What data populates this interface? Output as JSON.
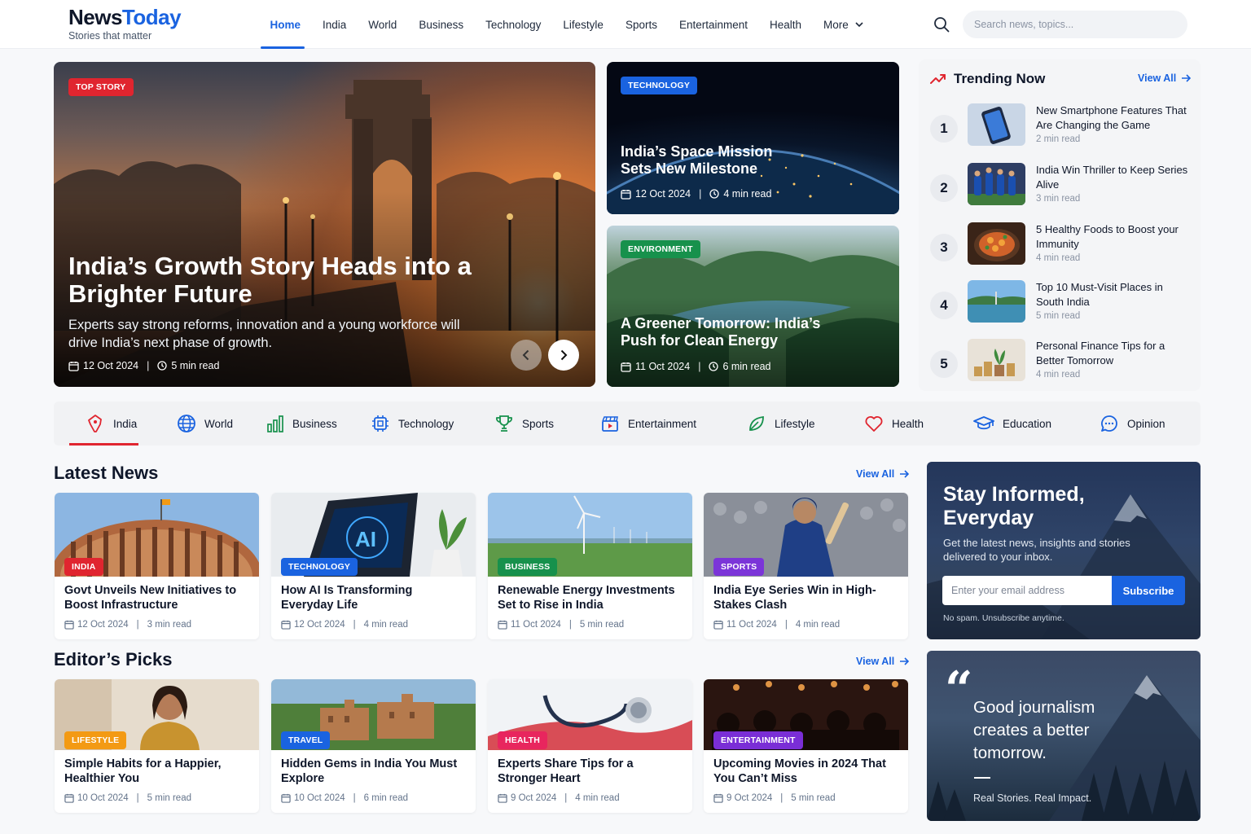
{
  "brand": {
    "name_a": "News",
    "name_b": "Today",
    "tagline": "Stories that matter",
    "accent": "#1a63e0"
  },
  "nav": {
    "items": [
      {
        "label": "Home",
        "active": true
      },
      {
        "label": "India"
      },
      {
        "label": "World"
      },
      {
        "label": "Business"
      },
      {
        "label": "Technology"
      },
      {
        "label": "Lifestyle"
      },
      {
        "label": "Sports"
      },
      {
        "label": "Entertainment"
      },
      {
        "label": "Health"
      },
      {
        "label": "More"
      }
    ]
  },
  "search": {
    "placeholder": "Search news, topics..."
  },
  "hero": {
    "badge": "TOP STORY",
    "title": "India’s Growth Story Heads into a Brighter Future",
    "subtitle": "Experts say strong reforms, innovation and a young workforce will drive India’s next phase of growth.",
    "date": "12 Oct 2024",
    "read": "5 min read"
  },
  "side_stories": [
    {
      "badge": "TECHNOLOGY",
      "title": "India’s Space Mission Sets New Milestone",
      "date": "12 Oct 2024",
      "read": "4 min read"
    },
    {
      "badge": "ENVIRONMENT",
      "title": "A Greener Tomorrow: India’s Push for Clean Energy",
      "date": "11 Oct 2024",
      "read": "6 min read"
    }
  ],
  "trending": {
    "title": "Trending Now",
    "view_all": "View All",
    "items": [
      {
        "num": "1",
        "title": "New Smartphone Features That Are Changing the Game",
        "read": "2 min read",
        "icon": "smartphone-image"
      },
      {
        "num": "2",
        "title": "India Win Thriller to Keep Series Alive",
        "read": "3 min read",
        "icon": "cricket-team-image"
      },
      {
        "num": "3",
        "title": "5 Healthy Foods to Boost your Immunity",
        "read": "4 min read",
        "icon": "food-bowl-image"
      },
      {
        "num": "4",
        "title": "Top 10 Must-Visit Places in South India",
        "read": "5 min read",
        "icon": "lake-landscape-image"
      },
      {
        "num": "5",
        "title": "Personal Finance Tips for a Better Tomorrow",
        "read": "4 min read",
        "icon": "coins-plant-image"
      }
    ]
  },
  "categories": [
    {
      "label": "India",
      "icon": "india-map-icon",
      "active": true
    },
    {
      "label": "World",
      "icon": "globe-icon"
    },
    {
      "label": "Business",
      "icon": "bar-chart-icon"
    },
    {
      "label": "Technology",
      "icon": "chip-icon"
    },
    {
      "label": "Sports",
      "icon": "trophy-icon"
    },
    {
      "label": "Entertainment",
      "icon": "clapperboard-icon"
    },
    {
      "label": "Lifestyle",
      "icon": "leaf-icon"
    },
    {
      "label": "Health",
      "icon": "heart-icon"
    },
    {
      "label": "Education",
      "icon": "graduation-cap-icon"
    },
    {
      "label": "Opinion",
      "icon": "chat-bubble-icon"
    }
  ],
  "latest": {
    "title": "Latest News",
    "view_all": "View All",
    "items": [
      {
        "badge": "INDIA",
        "title": "Govt Unveils New Initiatives to Boost Infrastructure",
        "date": "12 Oct 2024",
        "read": "3 min read",
        "color": "#e0252f"
      },
      {
        "badge": "TECHNOLOGY",
        "title": "How AI Is Transforming Everyday Life",
        "date": "12 Oct 2024",
        "read": "4 min read",
        "color": "#1a63e0"
      },
      {
        "badge": "BUSINESS",
        "title": "Renewable Energy Investments Set to Rise in India",
        "date": "11 Oct 2024",
        "read": "5 min read",
        "color": "#17914c"
      },
      {
        "badge": "SPORTS",
        "title": "India Eye Series Win in High-Stakes Clash",
        "date": "11 Oct 2024",
        "read": "4 min read",
        "color": "#7b35d8"
      }
    ]
  },
  "picks": {
    "title": "Editor’s Picks",
    "view_all": "View All",
    "items": [
      {
        "badge": "LIFESTYLE",
        "title": "Simple Habits for a Happier, Healthier You",
        "date": "10 Oct 2024",
        "read": "5 min read",
        "color": "#f39a14"
      },
      {
        "badge": "TRAVEL",
        "title": "Hidden Gems in India You Must Explore",
        "date": "10 Oct 2024",
        "read": "6 min read",
        "color": "#1a63e0"
      },
      {
        "badge": "HEALTH",
        "title": "Experts Share Tips for a Stronger Heart",
        "date": "9 Oct 2024",
        "read": "4 min read",
        "color": "#e8265e"
      },
      {
        "badge": "ENTERTAINMENT",
        "title": "Upcoming Movies in 2024 That You Can’t Miss",
        "date": "9 Oct 2024",
        "read": "5 min read",
        "color": "#7a2ed6"
      }
    ]
  },
  "newsletter": {
    "title": "Stay Informed, Everyday",
    "subtitle": "Get the latest news, insights and stories delivered to your inbox.",
    "placeholder": "Enter your email address",
    "button": "Subscribe",
    "note": "No spam. Unsubscribe anytime."
  },
  "quote": {
    "mark": "“",
    "text": "Good journalism creates a better tomorrow.",
    "footer": "Real Stories. Real Impact."
  }
}
